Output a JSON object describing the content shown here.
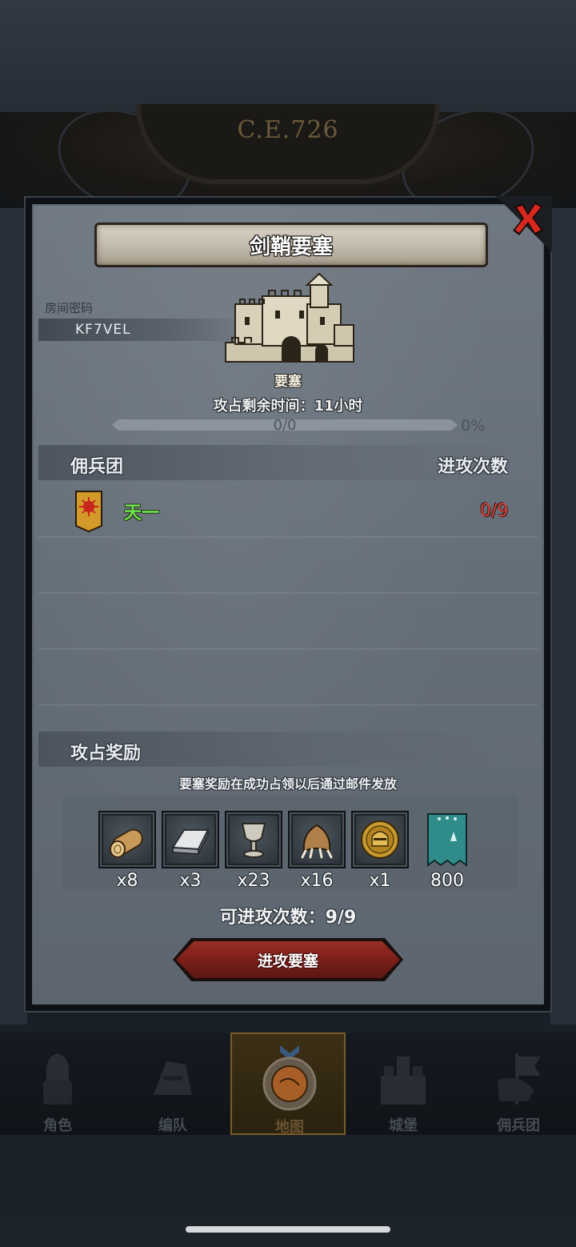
{
  "background": {
    "era_label": "C.E.726"
  },
  "dialog": {
    "title": "剑鞘要塞",
    "room": {
      "label": "房间密码",
      "code": "KF7VEL"
    },
    "building_type": "要塞",
    "capture_time_text": "攻占剩余时间：11小时",
    "progress": {
      "text": "0/0",
      "percent_text": "0%",
      "fraction": 0
    },
    "mercenary_section": {
      "title": "佣兵团",
      "attacks_header": "进攻次数",
      "rows": [
        {
          "name": "天一",
          "attacks": "0/9"
        }
      ]
    },
    "reward_section": {
      "title": "攻占奖励",
      "note": "要塞奖励在成功占领以后通过邮件发放",
      "items": [
        {
          "icon": "wood-log-icon",
          "count": "x8"
        },
        {
          "icon": "iron-ingot-icon",
          "count": "x3"
        },
        {
          "icon": "goblet-icon",
          "count": "x23"
        },
        {
          "icon": "beast-claw-icon",
          "count": "x16"
        },
        {
          "icon": "gold-helmet-coin-icon",
          "count": "x1"
        },
        {
          "icon": "guild-banner-icon",
          "count": "800"
        }
      ]
    },
    "attack_remaining": "可进攻次数：9/9",
    "attack_button": "进攻要塞"
  },
  "bottom_nav": [
    {
      "label": "角色",
      "active": false
    },
    {
      "label": "编队",
      "active": false
    },
    {
      "label": "地图",
      "active": true
    },
    {
      "label": "城堡",
      "active": false
    },
    {
      "label": "佣兵团",
      "active": false
    }
  ],
  "colors": {
    "merc_name": "#6de04c",
    "attacks_used": "#d8443a",
    "attack_button": "#8a2820",
    "close_x": "#d8281e"
  }
}
